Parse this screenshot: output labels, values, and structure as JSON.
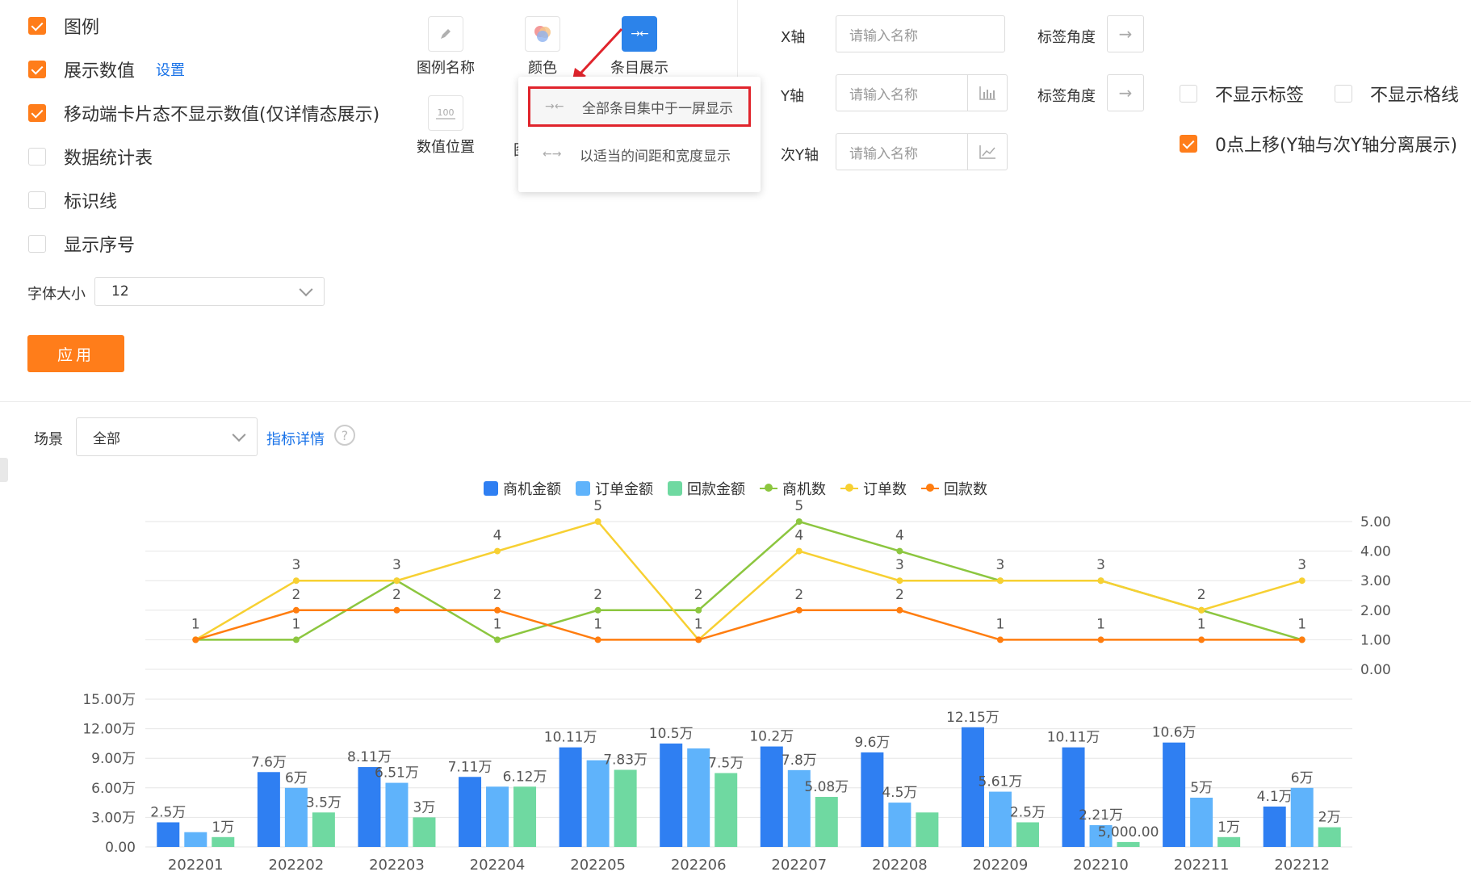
{
  "options": {
    "checkboxes": [
      {
        "label": "图例",
        "checked": true
      },
      {
        "label": "展示数值",
        "checked": true,
        "link": "设置"
      },
      {
        "label": "移动端卡片态不显示数值(仅详情态展示)",
        "checked": true
      },
      {
        "label": "数据统计表",
        "checked": false
      },
      {
        "label": "标识线",
        "checked": false
      },
      {
        "label": "显示序号",
        "checked": false
      }
    ],
    "font_size_label": "字体大小",
    "font_size_value": "12",
    "apply_label": "应用"
  },
  "tools": {
    "legend_name": "图例名称",
    "color": "颜色",
    "item_display": "条目展示",
    "value_position": "数值位置",
    "value_position_icon_text": "100",
    "partial_label": "图"
  },
  "dropdown_menu": {
    "items": [
      {
        "label": "全部条目集中于一屏显示",
        "selected": true
      },
      {
        "label": "以适当的间距和宽度显示",
        "selected": false
      }
    ]
  },
  "axes_settings": {
    "x_axis_label": "X轴",
    "y_axis_label": "Y轴",
    "y2_axis_label": "次Y轴",
    "name_placeholder": "请输入名称",
    "label_angle": "标签角度",
    "hide_labels": "不显示标签",
    "hide_gridlines": "不显示格线",
    "zero_shift": "0点上移(Y轴与次Y轴分离展示)",
    "hide_labels_checked": false,
    "hide_gridlines_checked": false,
    "zero_shift_checked": true
  },
  "filter": {
    "scene_label": "场景",
    "scene_value": "全部",
    "metric_detail_link": "指标详情"
  },
  "colors": {
    "accent": "#ff7d1a",
    "link": "#1a73e8",
    "active_tool": "#2c83ea"
  },
  "chart_data": {
    "type": "bar",
    "categories": [
      "202201",
      "202202",
      "202203",
      "202204",
      "202205",
      "202206",
      "202207",
      "202208",
      "202209",
      "202210",
      "202211",
      "202212"
    ],
    "bar_series": [
      {
        "name": "商机金额",
        "color": "#2f7ff2",
        "values": [
          2.5,
          7.6,
          8.11,
          7.11,
          10.11,
          10.5,
          10.2,
          9.6,
          12.15,
          10.11,
          10.6,
          4.1
        ],
        "labels": [
          "2.5万",
          "7.6万",
          "8.11万",
          "7.11万",
          "10.11万",
          "10.5万",
          "10.2万",
          "9.6万",
          "12.15万",
          "10.11万",
          "10.6万",
          "4.1万"
        ]
      },
      {
        "name": "订单金额",
        "color": "#5fb3fb",
        "values": [
          1.5,
          6,
          6.51,
          6.12,
          8.8,
          10,
          7.8,
          4.5,
          5.61,
          2.21,
          5,
          6
        ],
        "labels": [
          "",
          "6万",
          "6.51万",
          "",
          "",
          "",
          "7.8万",
          "4.5万",
          "5.61万",
          "2.21万",
          "5万",
          "6万"
        ]
      },
      {
        "name": "回款金额",
        "color": "#6fd9a1",
        "values": [
          1,
          3.5,
          3,
          6.12,
          7.83,
          7.5,
          5.08,
          3.5,
          2.5,
          0.5,
          1,
          2
        ],
        "labels": [
          "1万",
          "3.5万",
          "3万",
          "6.12万",
          "7.83万",
          "7.5万",
          "5.08万",
          "",
          "2.5万",
          "5,000.00",
          "1万",
          "2万"
        ]
      }
    ],
    "line_series": [
      {
        "name": "商机数",
        "color": "#8cc63f",
        "values": [
          1,
          1,
          3,
          1,
          2,
          2,
          5,
          4,
          3,
          3,
          2,
          1
        ]
      },
      {
        "name": "订单数",
        "color": "#f7d032",
        "values": [
          1,
          3,
          3,
          4,
          5,
          1,
          4,
          3,
          3,
          3,
          2,
          3
        ]
      },
      {
        "name": "回款数",
        "color": "#ff7d0f",
        "values": [
          1,
          2,
          2,
          2,
          1,
          1,
          2,
          2,
          1,
          1,
          1,
          1
        ]
      }
    ],
    "line_point_labels": [
      [
        "1"
      ],
      [
        "3",
        "2",
        "1"
      ],
      [
        "3",
        "2"
      ],
      [
        "4",
        "2",
        "1"
      ],
      [
        "5",
        "2",
        "1"
      ],
      [
        "2",
        "1"
      ],
      [
        "5",
        "4",
        "2"
      ],
      [
        "4",
        "3",
        "2"
      ],
      [
        "3",
        "1"
      ],
      [
        "3",
        "1"
      ],
      [
        "2",
        "1"
      ],
      [
        "3",
        "1"
      ]
    ],
    "y_left": {
      "ticks": [
        "0.00",
        "3.00万",
        "6.00万",
        "9.00万",
        "12.00万",
        "15.00万"
      ],
      "max": 15
    },
    "y_right": {
      "ticks": [
        "0.00",
        "1.00",
        "2.00",
        "3.00",
        "4.00",
        "5.00"
      ],
      "max": 5
    },
    "legend_position": "top-center",
    "grid": true
  }
}
